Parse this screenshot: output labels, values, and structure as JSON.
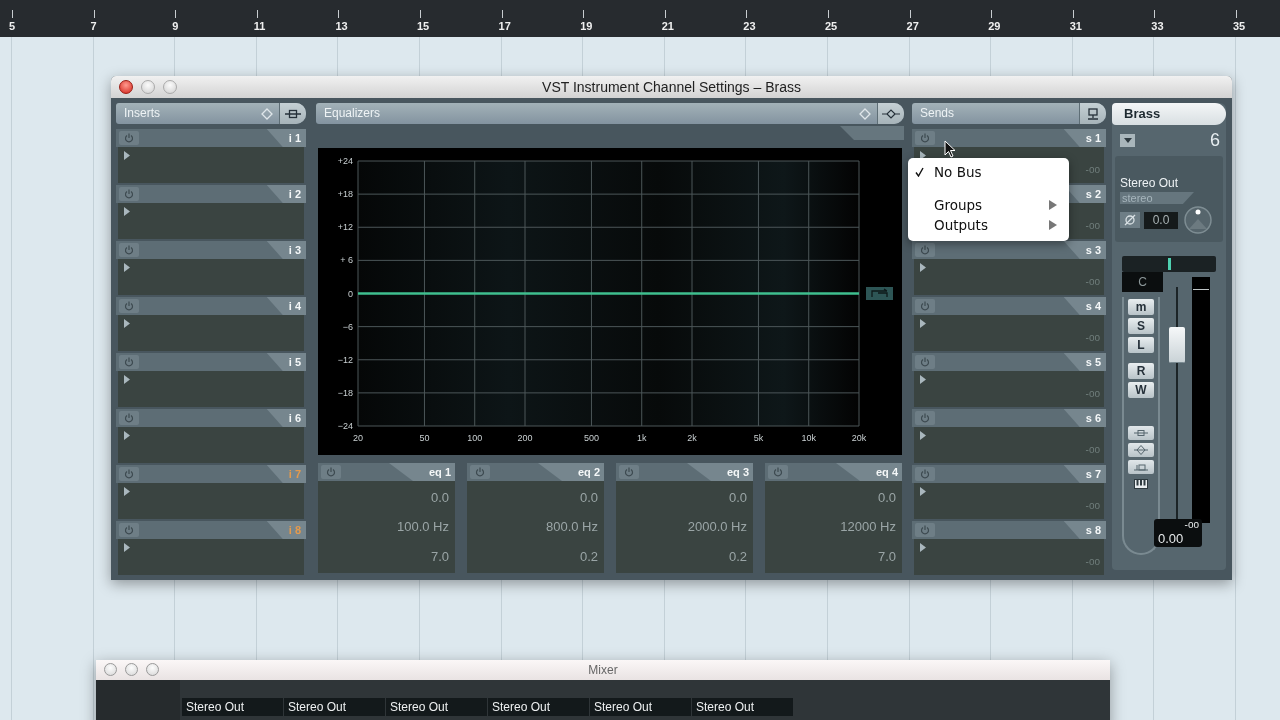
{
  "ruler": {
    "marks": [
      "5",
      "7",
      "9",
      "11",
      "13",
      "15",
      "17",
      "19",
      "21",
      "23",
      "25",
      "27",
      "29",
      "31",
      "33",
      "35"
    ]
  },
  "channel_window": {
    "title": "VST Instrument Channel Settings – Brass",
    "inserts": {
      "title": "Inserts",
      "slots": [
        {
          "label": "i 1",
          "post_fader": false
        },
        {
          "label": "i 2",
          "post_fader": false
        },
        {
          "label": "i 3",
          "post_fader": false
        },
        {
          "label": "i 4",
          "post_fader": false
        },
        {
          "label": "i 5",
          "post_fader": false
        },
        {
          "label": "i 6",
          "post_fader": false
        },
        {
          "label": "i 7",
          "post_fader": true
        },
        {
          "label": "i 8",
          "post_fader": true
        }
      ]
    },
    "equalizers": {
      "title": "Equalizers",
      "chart_data": {
        "type": "line",
        "grid": true,
        "categories": [
          "20",
          "50",
          "100",
          "200",
          "500",
          "1k",
          "2k",
          "5k",
          "10k",
          "20k"
        ],
        "ylim": [
          -24,
          24
        ],
        "series": [
          {
            "color": "#3fbf8f",
            "values": [
              0,
              0,
              0,
              0,
              0,
              0,
              0,
              0,
              0,
              0
            ]
          }
        ],
        "yticks": [
          {
            "value": 24,
            "label": "+24"
          },
          {
            "value": 18,
            "label": "+18"
          },
          {
            "value": 12,
            "label": "+12"
          },
          {
            "value": 6,
            "label": "+ 6"
          },
          {
            "value": 0,
            "label": "0"
          },
          {
            "value": -6,
            "label": "−6"
          },
          {
            "value": -12,
            "label": "−12"
          },
          {
            "value": -18,
            "label": "−18"
          },
          {
            "value": -24,
            "label": "−24"
          }
        ]
      },
      "bands": [
        {
          "label": "eq 1",
          "gain": "0.0",
          "frequency": "100.0 Hz",
          "q": "7.0"
        },
        {
          "label": "eq 2",
          "gain": "0.0",
          "frequency": "800.0 Hz",
          "q": "0.2"
        },
        {
          "label": "eq 3",
          "gain": "0.0",
          "frequency": "2000.0 Hz",
          "q": "0.2"
        },
        {
          "label": "eq 4",
          "gain": "0.0",
          "frequency": "12000 Hz",
          "q": "7.0"
        }
      ]
    },
    "sends": {
      "title": "Sends",
      "slots": [
        {
          "label": "s 1",
          "value": "-oo"
        },
        {
          "label": "s 2",
          "value": "-oo"
        },
        {
          "label": "s 3",
          "value": "-oo"
        },
        {
          "label": "s 4",
          "value": "-oo"
        },
        {
          "label": "s 5",
          "value": "-oo"
        },
        {
          "label": "s 6",
          "value": "-oo"
        },
        {
          "label": "s 7",
          "value": "-oo"
        },
        {
          "label": "s 8",
          "value": "-oo"
        }
      ]
    },
    "send_menu": {
      "items": [
        {
          "label": "No Bus",
          "checked": true,
          "submenu": false
        },
        {
          "label": "Groups",
          "checked": false,
          "submenu": true
        },
        {
          "label": "Outputs",
          "checked": false,
          "submenu": true
        }
      ]
    },
    "channel": {
      "name": "Brass",
      "number": "6",
      "output": "Stereo Out",
      "format": "stereo",
      "input_gain": "0.0",
      "pan": {
        "label": "C",
        "level": 0.5
      },
      "mode_buttons": [
        "m",
        "S",
        "L"
      ],
      "automation_buttons": [
        "R",
        "W"
      ],
      "section_toggles": [
        {
          "kind": "inserts",
          "on": false
        },
        {
          "kind": "eq",
          "on": false
        },
        {
          "kind": "sends",
          "on": false
        }
      ],
      "fader": {
        "level": 0.8
      },
      "peak": "-oo",
      "volume": "0.00"
    }
  },
  "mixer": {
    "title": "Mixer",
    "channels": [
      {
        "output": "Stereo Out"
      },
      {
        "output": "Stereo Out"
      },
      {
        "output": "Stereo Out"
      },
      {
        "output": "Stereo Out"
      },
      {
        "output": "Stereo Out"
      },
      {
        "output": "Stereo Out"
      }
    ]
  }
}
